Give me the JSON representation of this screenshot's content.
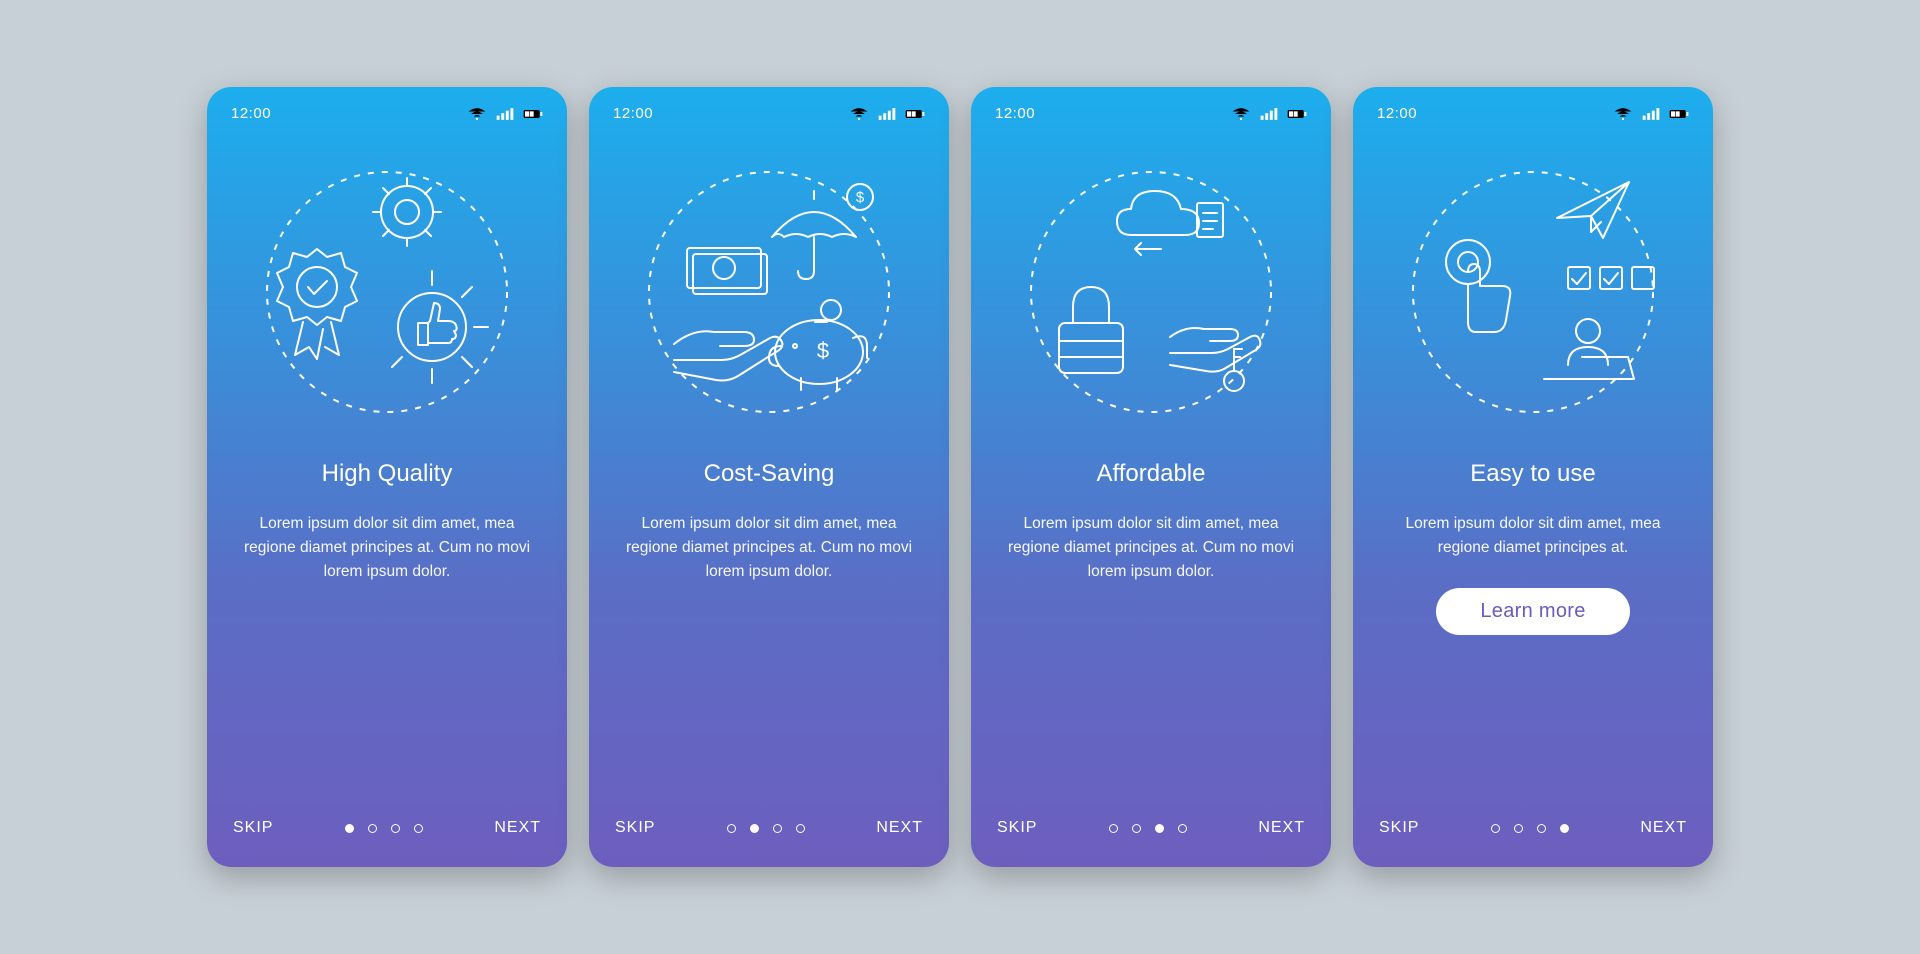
{
  "status_time": "12:00",
  "skip_label": "SKIP",
  "next_label": "NEXT",
  "learn_more_label": "Learn more",
  "screens": [
    {
      "title": "High Quality",
      "desc": "Lorem ipsum dolor sit dim amet, mea regione diamet principes at. Cum no movi lorem ipsum dolor.",
      "active_dot": 0,
      "has_cta": false
    },
    {
      "title": "Cost-Saving",
      "desc": "Lorem ipsum dolor sit dim amet, mea regione diamet principes at. Cum no movi lorem ipsum dolor.",
      "active_dot": 1,
      "has_cta": false
    },
    {
      "title": "Affordable",
      "desc": "Lorem ipsum dolor sit dim amet, mea regione diamet principes at. Cum no movi lorem ipsum dolor.",
      "active_dot": 2,
      "has_cta": false
    },
    {
      "title": "Easy to use",
      "desc": "Lorem ipsum dolor sit dim amet, mea regione diamet principes at.",
      "active_dot": 3,
      "has_cta": true
    }
  ]
}
